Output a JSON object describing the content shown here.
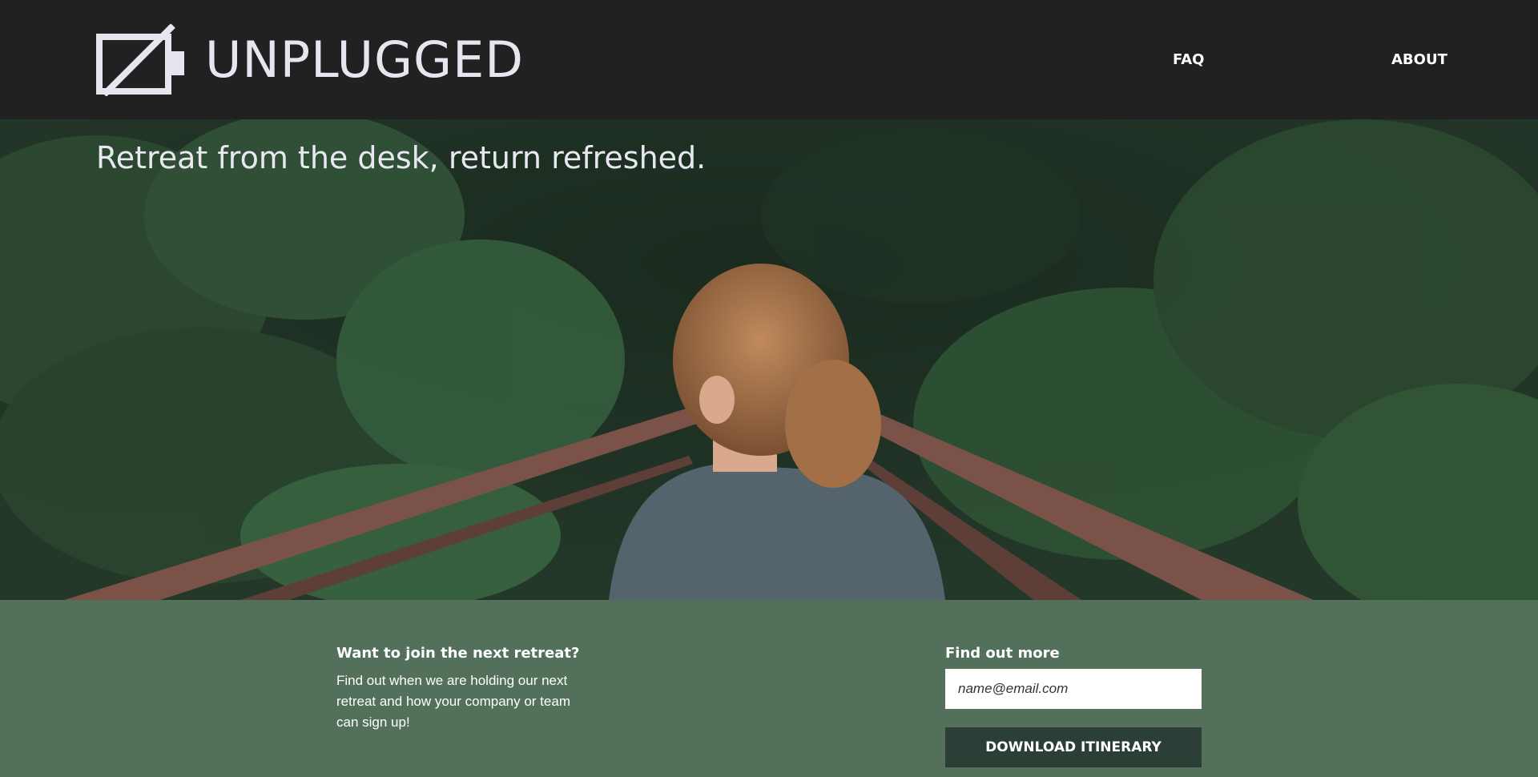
{
  "header": {
    "brand": "UNPLUGGED",
    "logo_icon": "battery-off-icon",
    "nav": [
      {
        "label": "FAQ"
      },
      {
        "label": "ABOUT"
      }
    ]
  },
  "hero": {
    "tagline": "Retreat from the desk, return refreshed.",
    "image": "photo of a woman on a wooden bridge in a green forest"
  },
  "signup": {
    "join_title": "Want to join the next retreat?",
    "join_text": "Find out when we are holding our next retreat and how your company or team can sign up!",
    "more_title": "Find out more",
    "email_placeholder": "name@email.com",
    "button_label": "DOWNLOAD ITINERARY"
  },
  "colors": {
    "header_bg": "#212121",
    "band_bg": "#53715a",
    "button_bg": "#2b3f36",
    "text_light": "#e6e6ef"
  }
}
